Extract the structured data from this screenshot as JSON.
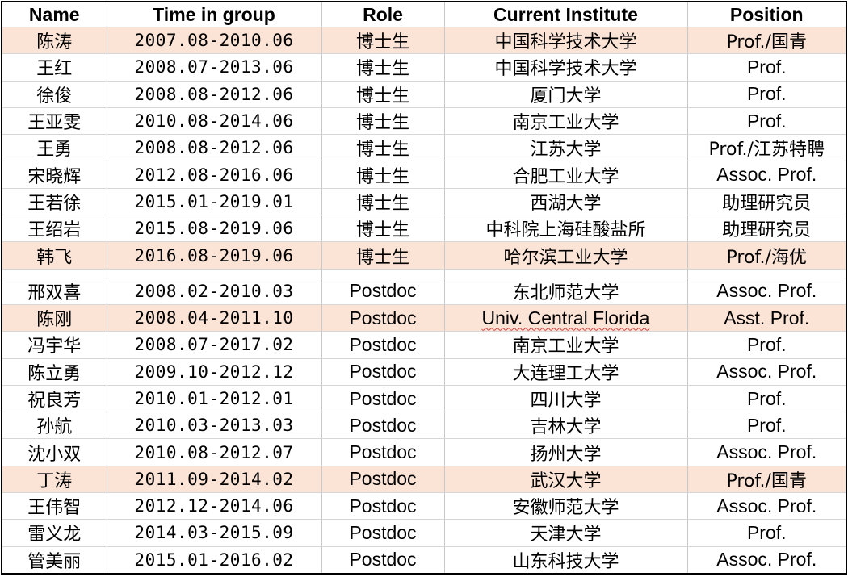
{
  "headers": {
    "name": "Name",
    "time": "Time in group",
    "role": "Role",
    "institute": "Current Institute",
    "position": "Position"
  },
  "highlight_color": "#fbe3d6",
  "phd_rows": [
    {
      "name": "陈涛",
      "time": "2007.08-2010.06",
      "role": "博士生",
      "institute": "中国科学技术大学",
      "position": "Prof./国青",
      "highlight": true
    },
    {
      "name": "王红",
      "time": "2008.07-2013.06",
      "role": "博士生",
      "institute": "中国科学技术大学",
      "position": "Prof.",
      "highlight": false
    },
    {
      "name": "徐俊",
      "time": "2008.08-2012.06",
      "role": "博士生",
      "institute": "厦门大学",
      "position": "Prof.",
      "highlight": false
    },
    {
      "name": "王亚雯",
      "time": "2010.08-2014.06",
      "role": "博士生",
      "institute": "南京工业大学",
      "position": "Prof.",
      "highlight": false
    },
    {
      "name": "王勇",
      "time": "2008.08-2012.06",
      "role": "博士生",
      "institute": "江苏大学",
      "position": "Prof./江苏特聘",
      "highlight": false
    },
    {
      "name": "宋晓辉",
      "time": "2012.08-2016.06",
      "role": "博士生",
      "institute": "合肥工业大学",
      "position": "Assoc. Prof.",
      "highlight": false
    },
    {
      "name": "王若徐",
      "time": "2015.01-2019.01",
      "role": "博士生",
      "institute": "西湖大学",
      "position": "助理研究员",
      "highlight": false
    },
    {
      "name": "王绍岩",
      "time": "2015.08-2019.06",
      "role": "博士生",
      "institute": "中科院上海硅酸盐所",
      "position": "助理研究员",
      "highlight": false
    },
    {
      "name": "韩飞",
      "time": "2016.08-2019.06",
      "role": "博士生",
      "institute": "哈尔滨工业大学",
      "position": "Prof./海优",
      "highlight": true
    }
  ],
  "postdoc_rows": [
    {
      "name": "邢双喜",
      "time": "2008.02-2010.03",
      "role": "Postdoc",
      "institute": "东北师范大学",
      "position": "Assoc. Prof.",
      "highlight": false
    },
    {
      "name": "陈刚",
      "time": "2008.04-2011.10",
      "role": "Postdoc",
      "institute": "Univ. Central Florida",
      "position": "Asst. Prof.",
      "highlight": true
    },
    {
      "name": "冯宇华",
      "time": "2008.07-2017.02",
      "role": "Postdoc",
      "institute": "南京工业大学",
      "position": "Prof.",
      "highlight": false
    },
    {
      "name": "陈立勇",
      "time": "2009.10-2012.12",
      "role": "Postdoc",
      "institute": "大连理工大学",
      "position": "Assoc. Prof.",
      "highlight": false
    },
    {
      "name": "祝良芳",
      "time": "2010.01-2012.01",
      "role": "Postdoc",
      "institute": "四川大学",
      "position": "Prof.",
      "highlight": false
    },
    {
      "name": "孙航",
      "time": "2010.03-2013.03",
      "role": "Postdoc",
      "institute": "吉林大学",
      "position": "Prof.",
      "highlight": false
    },
    {
      "name": "沈小双",
      "time": "2010.08-2012.07",
      "role": "Postdoc",
      "institute": "扬州大学",
      "position": "Assoc. Prof.",
      "highlight": false
    },
    {
      "name": "丁涛",
      "time": "2011.09-2014.02",
      "role": "Postdoc",
      "institute": "武汉大学",
      "position": "Prof./国青",
      "highlight": true
    },
    {
      "name": "王伟智",
      "time": "2012.12-2014.06",
      "role": "Postdoc",
      "institute": "安徽师范大学",
      "position": "Assoc. Prof.",
      "highlight": false
    },
    {
      "name": "雷义龙",
      "time": "2014.03-2015.09",
      "role": "Postdoc",
      "institute": "天津大学",
      "position": "Prof.",
      "highlight": false
    },
    {
      "name": "管美丽",
      "time": "2015.01-2016.02",
      "role": "Postdoc",
      "institute": "山东科技大学",
      "position": "Assoc. Prof.",
      "highlight": false
    }
  ]
}
